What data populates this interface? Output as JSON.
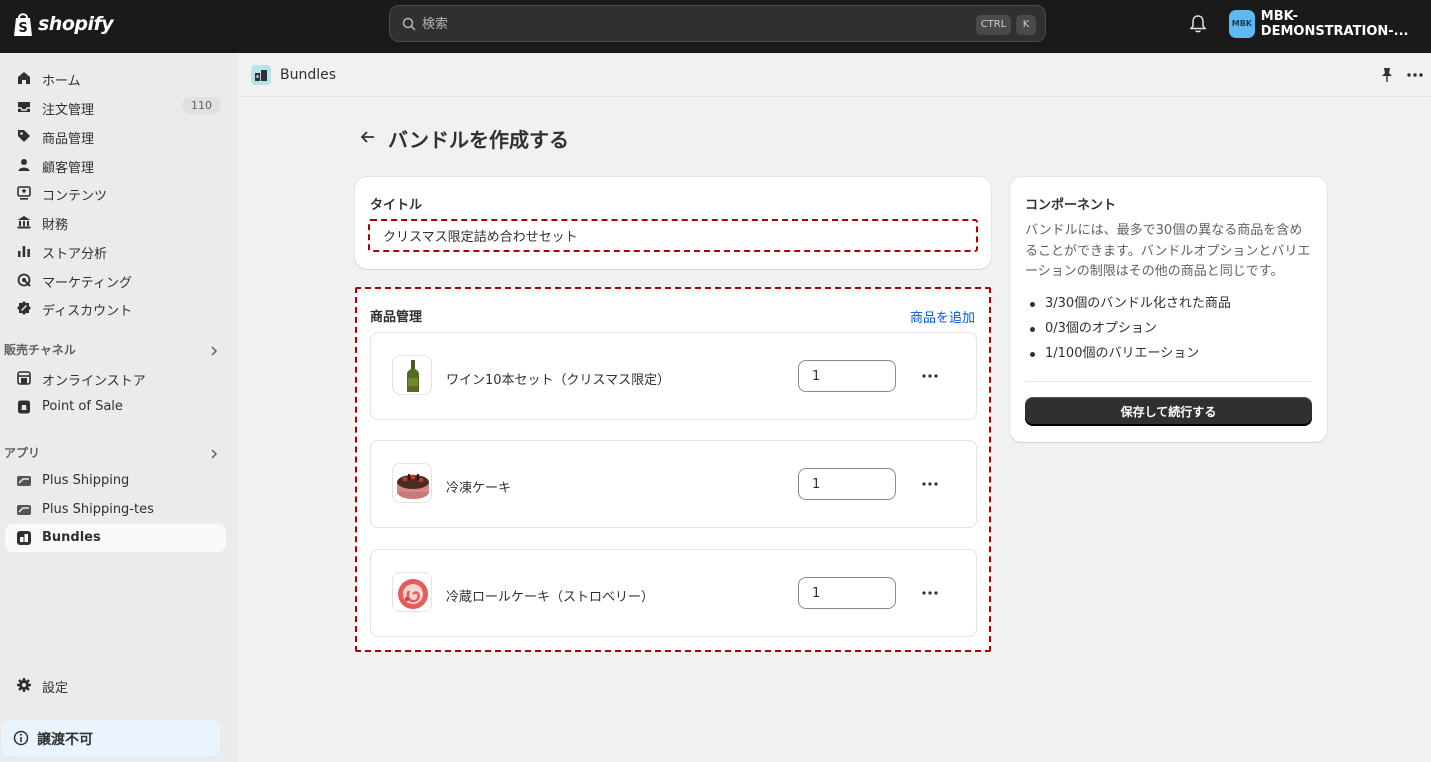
{
  "topbar": {
    "logo_text": "shopify",
    "search_placeholder": "検索",
    "shortcut_ctrl": "CTRL",
    "shortcut_k": "K",
    "store_avatar": "MBK",
    "store_name": "MBK-DEMONSTRATION-..."
  },
  "sidebar": {
    "main_items": [
      {
        "label": "ホーム",
        "icon": "home-icon"
      },
      {
        "label": "注文管理",
        "icon": "inbox-icon",
        "badge": "110"
      },
      {
        "label": "商品管理",
        "icon": "tag-icon"
      },
      {
        "label": "顧客管理",
        "icon": "person-icon"
      },
      {
        "label": "コンテンツ",
        "icon": "content-icon"
      },
      {
        "label": "財務",
        "icon": "bank-icon"
      },
      {
        "label": "ストア分析",
        "icon": "bar-chart-icon"
      },
      {
        "label": "マーケティング",
        "icon": "target-icon"
      },
      {
        "label": "ディスカウント",
        "icon": "discount-icon"
      }
    ],
    "sales_channels_heading": "販売チャネル",
    "sales_channels": [
      {
        "label": "オンラインストア",
        "icon": "store-icon"
      },
      {
        "label": "Point of Sale",
        "icon": "pos-icon"
      }
    ],
    "apps_heading": "アプリ",
    "apps": [
      {
        "label": "Plus Shipping",
        "icon": "truck-icon"
      },
      {
        "label": "Plus Shipping-tes",
        "icon": "truck-icon"
      },
      {
        "label": "Bundles",
        "icon": "bundles-icon",
        "active": true
      }
    ],
    "settings_label": "設定",
    "unsaved_label": "譲渡不可"
  },
  "appbar": {
    "app_name": "Bundles"
  },
  "page": {
    "title": "バンドルを作成する"
  },
  "title_card": {
    "label": "タイトル",
    "value": "クリスマス限定詰め合わせセット"
  },
  "products_card": {
    "label": "商品管理",
    "add_link": "商品を追加",
    "items": [
      {
        "name": "ワイン10本セット（クリスマス限定）",
        "quantity": "1",
        "thumb": "wine-bottle-image"
      },
      {
        "name": "冷凍ケーキ",
        "quantity": "1",
        "thumb": "chocolate-cake-image"
      },
      {
        "name": "冷蔵ロールケーキ（ストロベリー）",
        "quantity": "1",
        "thumb": "roll-cake-image"
      }
    ]
  },
  "components_card": {
    "title": "コンポーネント",
    "description": "バンドルには、最多で30個の異なる商品を含めることができます。バンドルオプションとバリエーションの制限はその他の商品と同じです。",
    "stats": [
      "3/30個のバンドル化された商品",
      "0/3個のオプション",
      "1/100個のバリエーション"
    ],
    "save_button": "保存して続行する"
  },
  "colors": {
    "topbar": "#1a1a1a",
    "sidebar": "#ebebeb",
    "link": "#005bd3",
    "highlight_border": "#aa0000",
    "primary_button": "#303030"
  }
}
